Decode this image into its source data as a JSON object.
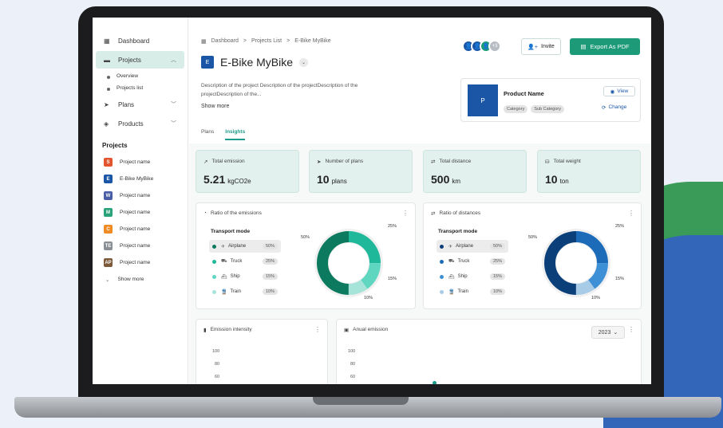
{
  "sidebar": {
    "dashboard": "Dashboard",
    "projects": "Projects",
    "overview": "Overview",
    "projects_list": "Projects list",
    "plans": "Plans",
    "products": "Products",
    "projects_heading": "Projects",
    "items": [
      {
        "label": "Project name",
        "icon": "S",
        "color": "#e2552f"
      },
      {
        "label": "E-Bike MyBike",
        "icon": "E",
        "color": "#1a56a5"
      },
      {
        "label": "Project name",
        "icon": "W",
        "color": "#4a5ea8"
      },
      {
        "label": "Project name",
        "icon": "M",
        "color": "#2aa37a"
      },
      {
        "label": "Project name",
        "icon": "C",
        "color": "#f08a24"
      },
      {
        "label": "Project name",
        "icon": "TE",
        "color": "#8a8f96"
      },
      {
        "label": "Project name",
        "icon": "AP",
        "color": "#7c5a3a"
      }
    ],
    "show_more": "Show more"
  },
  "breadcrumb": [
    "Dashboard",
    ">",
    "Projects List",
    ">",
    "E-Bike MyBike"
  ],
  "project": {
    "badge": "E",
    "title": "E-Bike MyBike",
    "description": "Description of the project Description of the projectDescription of the projectDescription of the...",
    "show_more": "Show more"
  },
  "tabs": [
    "Plans",
    "Insights"
  ],
  "header": {
    "avatars_more": "+3",
    "invite": "Invite",
    "export": "Export As PDF"
  },
  "product": {
    "img_letter": "P",
    "name": "Product Name",
    "category": "Category",
    "sub_category": "Sub Category",
    "view": "View",
    "change": "Change"
  },
  "stats": [
    {
      "label": "Total emission",
      "value": "5.21",
      "unit": "kgCO2e",
      "icon": "trend-icon"
    },
    {
      "label": "Number of plans",
      "value": "10",
      "unit": "plans",
      "icon": "send-icon"
    },
    {
      "label": "Total distance",
      "value": "500",
      "unit": "km",
      "icon": "swap-icon"
    },
    {
      "label": "Total weight",
      "value": "10",
      "unit": "ton",
      "icon": "weight-icon"
    }
  ],
  "emissions_panel": {
    "title": "Ratio of the emissions",
    "mode_title": "Transport mode",
    "modes": [
      {
        "label": "Airplane",
        "pct": "50%"
      },
      {
        "label": "Truck",
        "pct": "25%"
      },
      {
        "label": "Ship",
        "pct": "15%"
      },
      {
        "label": "Train",
        "pct": "10%"
      }
    ],
    "colors": [
      "#0b7a5e",
      "#1fb89a",
      "#5fd6c0",
      "#a6e3d8"
    ]
  },
  "distance_panel": {
    "title": "Ratio of distances",
    "mode_title": "Transport mode",
    "modes": [
      {
        "label": "Airplane",
        "pct": "50%"
      },
      {
        "label": "Truck",
        "pct": "25%"
      },
      {
        "label": "Ship",
        "pct": "15%"
      },
      {
        "label": "Train",
        "pct": "10%"
      }
    ],
    "colors": [
      "#0b3f7a",
      "#1b6bb8",
      "#3d8fd6",
      "#a8cce8"
    ]
  },
  "intensity_panel": {
    "title": "Emission intensity",
    "y": [
      "100",
      "80",
      "60"
    ]
  },
  "annual_panel": {
    "title": "Anual emission",
    "year": "2023",
    "y": [
      "100",
      "80",
      "60"
    ]
  },
  "donut_values": [
    50,
    25,
    15,
    10
  ]
}
